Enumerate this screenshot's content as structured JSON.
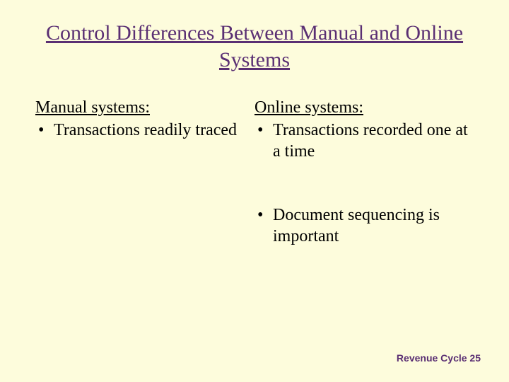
{
  "title": "Control Differences Between Manual and Online Systems",
  "left": {
    "heading": "Manual systems:",
    "items": [
      "Transactions readily traced"
    ]
  },
  "right": {
    "heading": "Online systems:",
    "items": [
      "Transactions recorded one at a time",
      "Document sequencing is important"
    ]
  },
  "footer": "Revenue Cycle 25"
}
